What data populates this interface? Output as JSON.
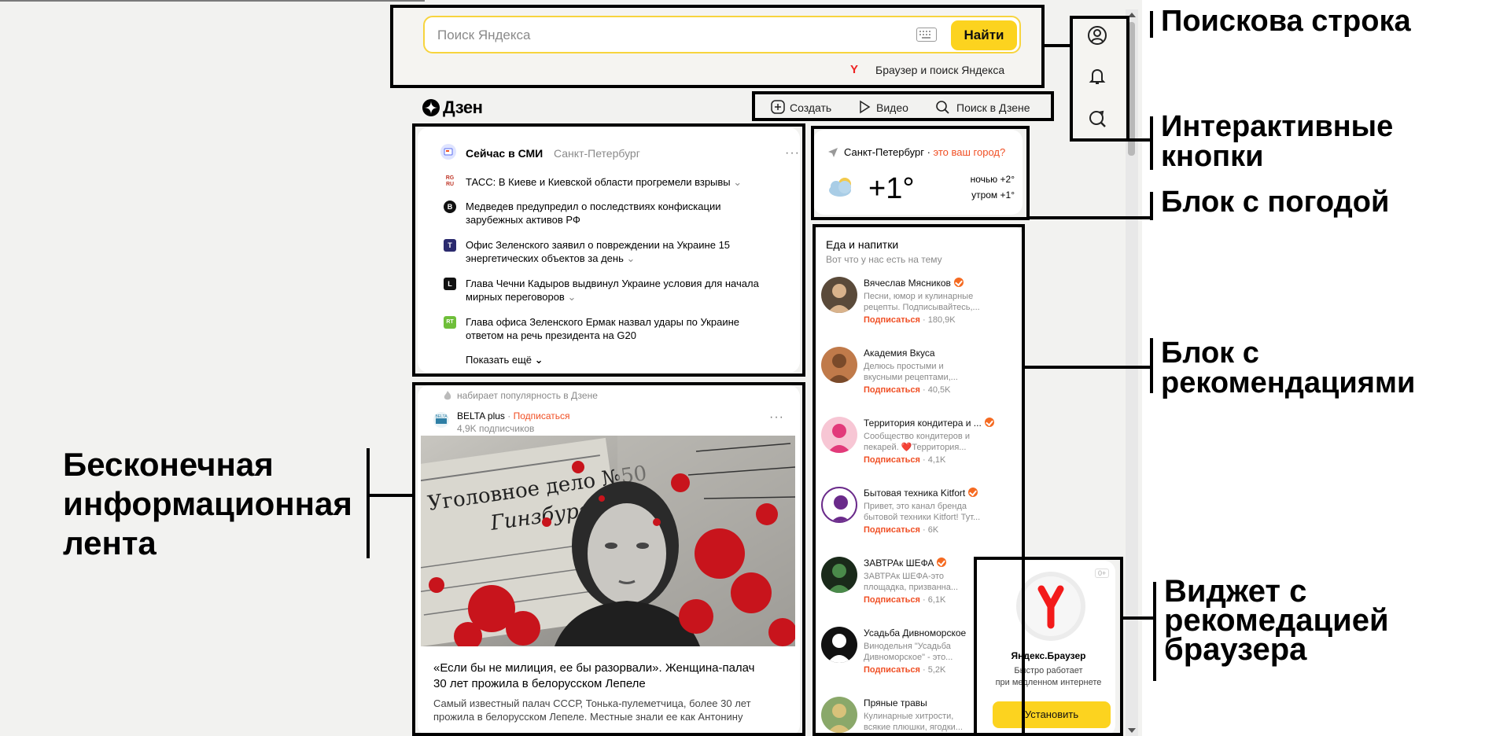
{
  "search": {
    "placeholder": "Поиск Яндекса",
    "button_label": "Найти",
    "browser_link": "Браузер и поиск Яндекса"
  },
  "dzen": {
    "logo_text": "Дзен",
    "toolbar": {
      "create": "Создать",
      "video": "Видео",
      "search": "Поиск в Дзене"
    }
  },
  "news": {
    "title": "Сейчас в СМИ",
    "city": "Санкт-Петербург",
    "items": [
      {
        "source_icon": "RG RU",
        "text": "ТАСС: В Киеве и Киевской области прогремели взрывы",
        "text2": ""
      },
      {
        "source_icon": "B",
        "text": "Медведев предупредил о последствиях конфискации",
        "text2": "зарубежных активов РФ"
      },
      {
        "source_icon": "T",
        "text": "Офис Зеленского заявил о повреждении на Украине 15",
        "text2": "энергетических объектов за день"
      },
      {
        "source_icon": "L",
        "text": "Глава Чечни Кадыров выдвинул Украине условия для начала",
        "text2": "мирных переговоров"
      },
      {
        "source_icon": "RT",
        "text": "Глава офиса Зеленского Ермак назвал удары по Украине",
        "text2": "ответом на речь президента на G20"
      }
    ],
    "show_more": "Показать ещё"
  },
  "weather": {
    "city": "Санкт-Петербург",
    "separator": " · ",
    "question": "это ваш город?",
    "temp": "+1°",
    "night": "ночью +2°",
    "morning": "утром +1°"
  },
  "recommendations": {
    "title": "Еда и напитки",
    "subtitle": "Вот что у нас есть на тему",
    "subscribe_label": "Подписаться",
    "items": [
      {
        "name": "Вячеслав Мясников",
        "verified": true,
        "desc1": "Песни, юмор и кулинарные",
        "desc2": "рецепты. Подписывайтесь,...",
        "count": "180,9K"
      },
      {
        "name": "Академия Вкуса",
        "verified": false,
        "desc1": "Делюсь простыми и",
        "desc2": "вкусными рецептами,...",
        "count": "40,5K"
      },
      {
        "name": "Территория кондитера и ...",
        "verified": true,
        "desc1": "Сообщество кондитеров и",
        "desc2": "пекарей. ❤️Территория...",
        "count": "4,1K"
      },
      {
        "name": "Бытовая техника Kitfort",
        "verified": true,
        "desc1": "Привет, это канал бренда",
        "desc2": "бытовой техники Kitfort! Тут...",
        "count": "6K"
      },
      {
        "name": "ЗАВТРАк ШЕФА",
        "verified": true,
        "desc1": "ЗАВТРАк ШЕФА-это",
        "desc2": "площадка, призванна...",
        "count": "6,1K"
      },
      {
        "name": "Усадьба Дивноморское",
        "verified": false,
        "desc1": "Винодельня \"Усадьба",
        "desc2": "Дивноморское\" - это...",
        "count": "5,2K"
      },
      {
        "name": "Пряные травы",
        "verified": false,
        "desc1": "Кулинарные хитрости,",
        "desc2": "всякие плюшки, ягодки...",
        "count": ""
      }
    ]
  },
  "feed": {
    "trending": "набирает популярность в Дзене",
    "channel": "BELTA plus",
    "subscribe": "Подписаться",
    "subscribers": "4,9K подписчиков",
    "headline1": "«Если бы не милиция, ее бы разорвали». Женщина-палач",
    "headline2": "30 лет прожила в белорусском Лепеле",
    "snippet1": "Самый известный палач СССР, Тонька-пулеметчица, более 30 лет",
    "snippet2": "прожила в белорусском Лепеле. Местные знали ее как Антонину",
    "image_text1": "Уголовное дело №50",
    "image_text2": "Гинзбург"
  },
  "browser_widget": {
    "age": "0+",
    "title": "Яндекс.Браузер",
    "line1": "Быстро работает",
    "line2": "при медленном интернете",
    "install": "Установить"
  },
  "annotations": {
    "search_bar": "Поискова строка",
    "interactive_buttons": "Интерактивные\nкнопки",
    "weather_block": "Блок с погодой",
    "recommendations_block": "Блок с\nрекомендациями",
    "infinite_feed": "Бесконечная\nинформационная\nлента",
    "browser_widget": "Виджет с\nрекомедацией\nбраузера"
  },
  "colors": {
    "accent_yellow": "#fcd31f",
    "subscribe_orange": "#f04e23",
    "page_bg": "#f2f2f0"
  }
}
